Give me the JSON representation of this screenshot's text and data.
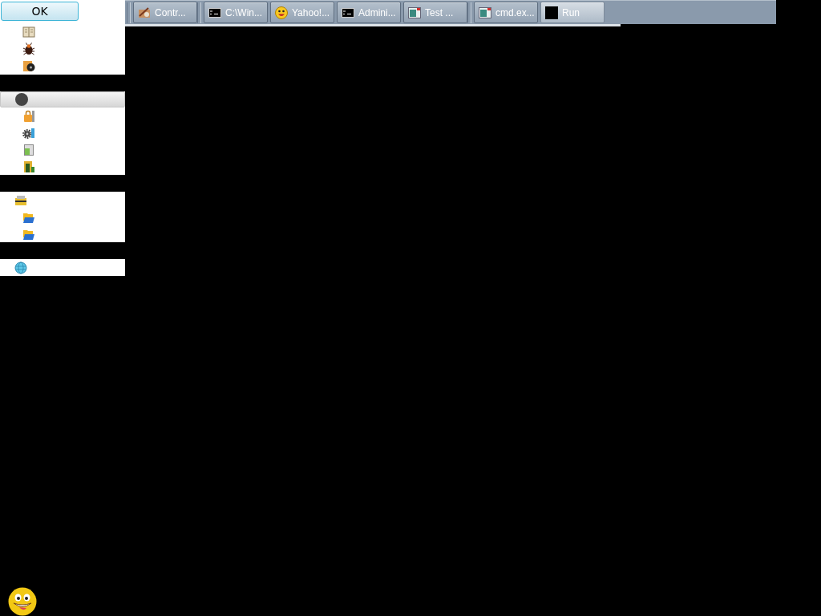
{
  "ok_button": {
    "label": "OK"
  },
  "panel": {
    "groups": [
      {
        "items": [
          {
            "kind": "book"
          },
          {
            "kind": "bug"
          },
          {
            "kind": "media"
          }
        ]
      },
      {
        "header": {
          "kind": "dot",
          "bar": true
        },
        "items": [
          {
            "kind": "padlock"
          },
          {
            "kind": "gear"
          },
          {
            "kind": "document"
          },
          {
            "kind": "tower"
          }
        ]
      },
      {
        "header": {
          "kind": "toolbox",
          "bar": false
        },
        "items": [
          {
            "kind": "folder"
          },
          {
            "kind": "folder"
          }
        ]
      },
      {
        "header": {
          "kind": "globe",
          "bar": false
        }
      }
    ]
  },
  "taskbar": {
    "groups": [
      {
        "buttons": [
          {
            "label": "Contr...",
            "kind": "tools",
            "selected": false
          }
        ]
      },
      {
        "buttons": [
          {
            "label": "C:\\Win...",
            "kind": "console",
            "selected": false
          },
          {
            "label": "Yahoo!...",
            "kind": "smiley",
            "selected": false
          },
          {
            "label": "Admini...",
            "kind": "console",
            "selected": false
          },
          {
            "label": "Test ...",
            "kind": "window",
            "selected": false
          }
        ]
      },
      {
        "buttons": [
          {
            "label": "cmd.ex...",
            "kind": "window",
            "selected": false
          },
          {
            "label": "Run",
            "kind": "square",
            "selected": true
          }
        ]
      }
    ]
  }
}
